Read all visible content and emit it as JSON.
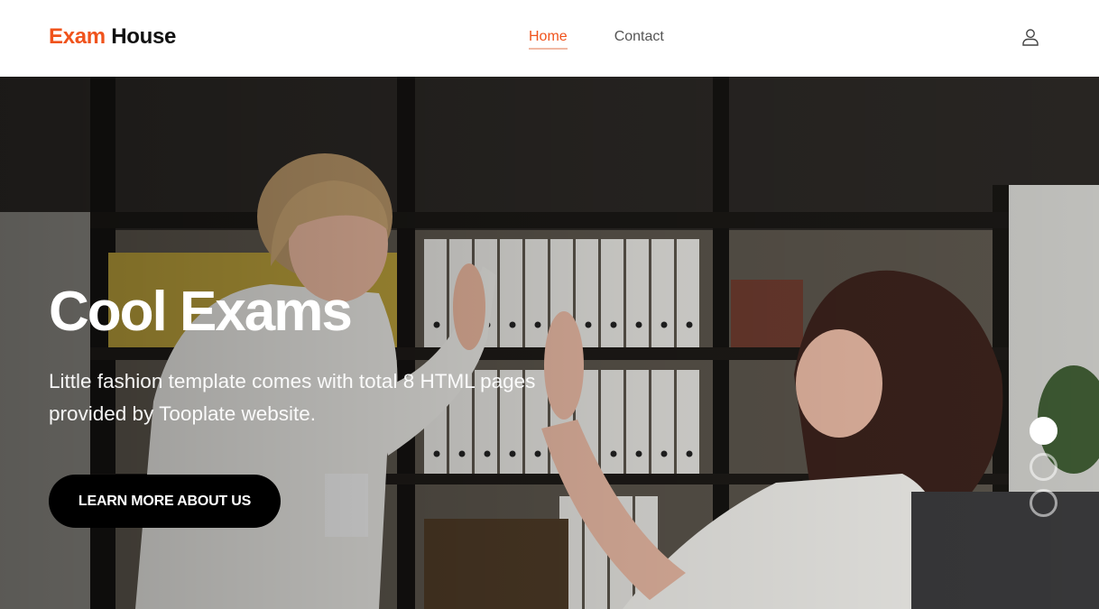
{
  "brand": {
    "part1": "Exam",
    "part2": "House"
  },
  "nav": {
    "items": [
      {
        "label": "Home"
      },
      {
        "label": "Contact"
      }
    ]
  },
  "icons": {
    "user": "user-icon"
  },
  "hero": {
    "title": "Cool Exams",
    "text": "Little fashion template comes with total 8 HTML pages provided by Tooplate website.",
    "cta_label": "LEARN MORE ABOUT US"
  },
  "slider": {
    "dots": 3,
    "active_index": 0
  },
  "colors": {
    "accent": "#f0531c",
    "cta_bg": "#000000",
    "text_dark": "#111111"
  }
}
